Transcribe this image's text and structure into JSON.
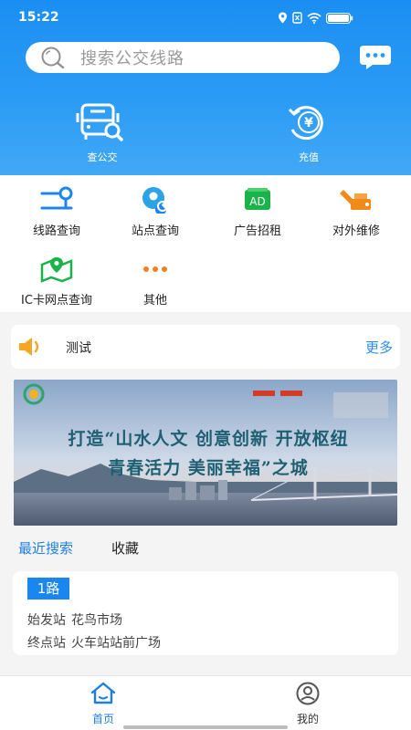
{
  "status_bar": {
    "time": "15:22"
  },
  "search": {
    "placeholder": "搜索公交线路"
  },
  "quick_actions": [
    {
      "label": "查公交",
      "icon": "bus-search-icon"
    },
    {
      "label": "充值",
      "icon": "yuan-recharge-icon"
    }
  ],
  "services": [
    {
      "label": "线路查询",
      "icon": "route-query-icon"
    },
    {
      "label": "站点查询",
      "icon": "station-query-icon"
    },
    {
      "label": "广告招租",
      "icon": "ad-icon"
    },
    {
      "label": "对外维修",
      "icon": "repair-icon"
    },
    {
      "label": "IC卡网点查询",
      "icon": "map-pin-icon"
    },
    {
      "label": "其他",
      "icon": "more-dots-icon"
    }
  ],
  "notice": {
    "text": "测试",
    "more_label": "更多"
  },
  "banner": {
    "headline_1": "打造“山水人文 创意创新 开放枢纽",
    "headline_2": "青春活力 美丽幸福”之城"
  },
  "history_tabs": {
    "recent": "最近搜索",
    "favorites": "收藏"
  },
  "recent_route": {
    "name": "1路",
    "start_label": "始发站",
    "start_value": "花鸟市场",
    "end_label": "终点站",
    "end_value": "火车站站前广场"
  },
  "tabbar": [
    {
      "label": "首页",
      "icon": "home-icon"
    },
    {
      "label": "我的",
      "icon": "profile-icon"
    }
  ],
  "colors": {
    "primary": "#1b8ef3",
    "active_tab": "#1f7fe0",
    "badge": "#1a86f0"
  }
}
